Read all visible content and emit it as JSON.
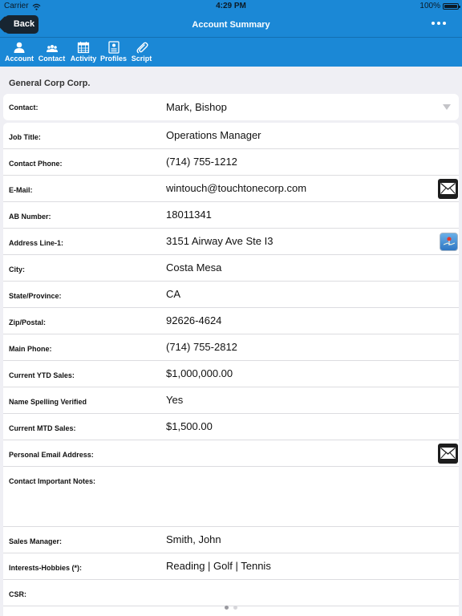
{
  "status_bar": {
    "carrier": "Carrier",
    "time": "4:29 PM",
    "battery": "100%"
  },
  "nav": {
    "back_label": "Back",
    "title": "Account Summary",
    "menu_icon": "ellipsis-icon"
  },
  "toolbar": {
    "items": [
      {
        "label": "Account",
        "icon": "person-icon"
      },
      {
        "label": "Contact",
        "icon": "group-icon"
      },
      {
        "label": "Activity",
        "icon": "calendar-icon"
      },
      {
        "label": "Profiles",
        "icon": "profile-card-icon"
      },
      {
        "label": "Script",
        "icon": "paperclip-icon"
      }
    ]
  },
  "account": {
    "company": "General Corp Corp.",
    "contact_label": "Contact:",
    "contact_value": "Mark, Bishop"
  },
  "fields": [
    {
      "label": "Job Title:",
      "value": "Operations Manager"
    },
    {
      "label": "Contact Phone:",
      "value": "(714) 755-1212"
    },
    {
      "label": "E-Mail:",
      "value": "wintouch@touchtonecorp.com",
      "icon": "mail-icon"
    },
    {
      "label": "AB Number:",
      "value": "18011341"
    },
    {
      "label": "Address Line-1:",
      "value": "3151 Airway Ave Ste I3",
      "icon": "map-icon"
    },
    {
      "label": "City:",
      "value": "Costa Mesa"
    },
    {
      "label": "State/Province:",
      "value": "CA"
    },
    {
      "label": "Zip/Postal:",
      "value": "92626-4624"
    },
    {
      "label": "Main Phone:",
      "value": "(714) 755-2812"
    },
    {
      "label": "Current YTD Sales:",
      "value": "$1,000,000.00"
    },
    {
      "label": "Name Spelling Verified",
      "value": "Yes"
    },
    {
      "label": "Current MTD Sales:",
      "value": "$1,500.00"
    },
    {
      "label": "Personal Email Address:",
      "value": "",
      "icon": "mail-icon"
    },
    {
      "label": "Contact Important Notes:",
      "value": ""
    },
    {
      "label": "Sales Manager:",
      "value": "Smith, John"
    },
    {
      "label": "Interests-Hobbies (*):",
      "value": "Reading | Golf | Tennis"
    },
    {
      "label": "CSR:",
      "value": ""
    }
  ],
  "pager": {
    "pages": 2,
    "current": 1
  }
}
